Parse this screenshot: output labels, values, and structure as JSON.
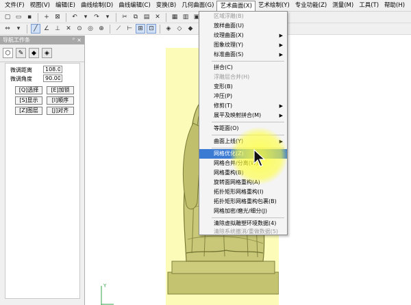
{
  "menubar": {
    "items": [
      {
        "label": "文件(F)"
      },
      {
        "label": "视图(V)"
      },
      {
        "label": "编辑(E)"
      },
      {
        "label": "曲线绘制(D)"
      },
      {
        "label": "曲线编辑(C)"
      },
      {
        "label": "变换(B)"
      },
      {
        "label": "几何曲面(G)"
      },
      {
        "label": "艺术曲面(X)",
        "active": true
      },
      {
        "label": "艺术绘制(Y)"
      },
      {
        "label": "专业功能(Z)"
      },
      {
        "label": "测量(M)"
      },
      {
        "label": "工具(T)"
      },
      {
        "label": "帮助(H)"
      }
    ]
  },
  "panel": {
    "title": "导航工作条",
    "pin_glyph": "ᴾ",
    "close_glyph": "×",
    "tabs": [
      "⬡",
      "✎",
      "◆",
      "◈"
    ],
    "distance_label": "微调距离",
    "distance_value": "108.00",
    "angle_label": "微调角度",
    "angle_value": "90.000",
    "buttons": [
      {
        "label": "[Q]选择"
      },
      {
        "label": "[E]加锁"
      },
      {
        "label": "[S]显示"
      },
      {
        "label": "[I]顺序"
      },
      {
        "label": "[Z]图层"
      },
      {
        "label": "[J]对齐"
      }
    ]
  },
  "dropdown": {
    "items": [
      {
        "label": "区域浮雕(B)",
        "disabled": true
      },
      {
        "label": "放样曲面(U)"
      },
      {
        "label": "纹理曲面(X)",
        "submenu": true
      },
      {
        "label": "图象纹理(Y)",
        "submenu": true
      },
      {
        "label": "标准曲面(S)",
        "submenu": true
      },
      {
        "label": "拼合(C)"
      },
      {
        "label": "浮雕层合并(H)",
        "disabled": true
      },
      {
        "label": "变形(B)"
      },
      {
        "label": "冲压(P)"
      },
      {
        "label": "修剪(T)",
        "submenu": true
      },
      {
        "label": "展平及映射拼合(M)",
        "submenu": true
      },
      {
        "label": "等距面(O)"
      },
      {
        "label": "曲面上线(Y)",
        "submenu": true
      },
      {
        "label": "网格优化(Z)",
        "highlighted": true
      },
      {
        "label": "网格合并/分离(W)"
      },
      {
        "label": "网格重构(B)"
      },
      {
        "label": "旋转面网格重构(A)"
      },
      {
        "label": "拓扑矩形网格重构(I)"
      },
      {
        "label": "拓扑矩形网格重构包裹(B)"
      },
      {
        "label": "网格加密/磨光/细分(J)"
      },
      {
        "label": "清除虚拟雕塑环境数据(4)"
      },
      {
        "label": "清除系统撤消/重做数据(5)",
        "disabled": true
      }
    ]
  },
  "colors": {
    "canvas_pane": "#fcfcb8",
    "statue": "#c8c878",
    "highlight": "#3b7bd4",
    "spotlight": "#ffff3c"
  },
  "canvas": {
    "axis_label": "Y"
  }
}
